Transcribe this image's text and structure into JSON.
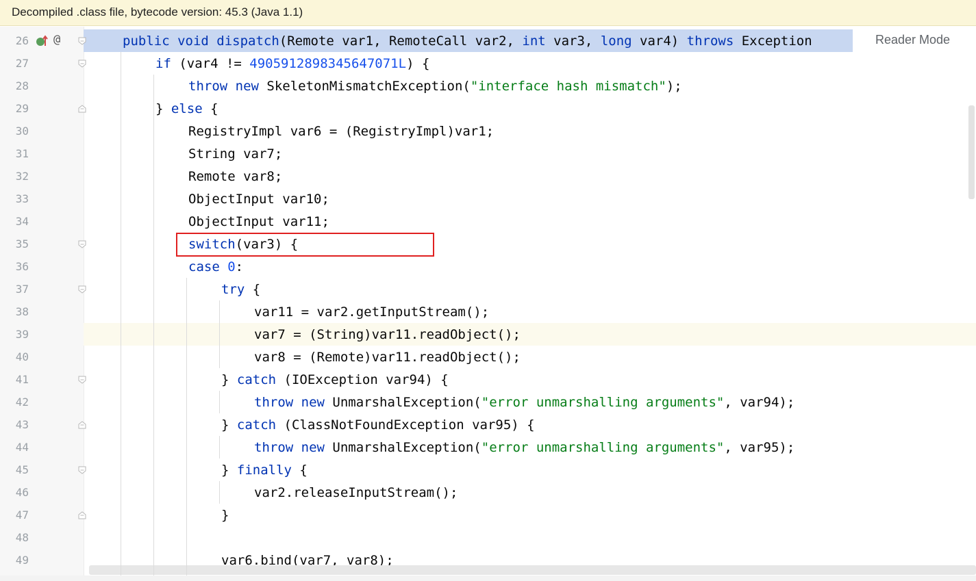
{
  "banner": {
    "text": "Decompiled .class file, bytecode version: 45.3 (Java 1.1)"
  },
  "reader_mode": {
    "label": "Reader Mode"
  },
  "gutter_icons": {
    "implements": "implements-up-icon",
    "annotation": "@"
  },
  "lines": [
    {
      "num": "26",
      "indent": 0,
      "tokens": [
        [
          "kw",
          "public "
        ],
        [
          "kw",
          "void "
        ],
        [
          "kw",
          "dispatch"
        ],
        [
          "",
          "(Remote var1, RemoteCall var2, "
        ],
        [
          "kw",
          "int "
        ],
        [
          "",
          "var3, "
        ],
        [
          "kw",
          "long "
        ],
        [
          "",
          "var4) "
        ],
        [
          "kw",
          "throws "
        ],
        [
          "",
          "Exception"
        ]
      ]
    },
    {
      "num": "27",
      "indent": 1,
      "tokens": [
        [
          "kw",
          "if "
        ],
        [
          "",
          "(var4 != "
        ],
        [
          "num",
          "4905912898345647071L"
        ],
        [
          "",
          ") {"
        ]
      ]
    },
    {
      "num": "28",
      "indent": 2,
      "tokens": [
        [
          "kw",
          "throw "
        ],
        [
          "kw",
          "new "
        ],
        [
          "",
          "SkeletonMismatchException("
        ],
        [
          "str",
          "\"interface hash mismatch\""
        ],
        [
          "",
          ");"
        ]
      ]
    },
    {
      "num": "29",
      "indent": 1,
      "tokens": [
        [
          "",
          "} "
        ],
        [
          "kw",
          "else "
        ],
        [
          "",
          "{"
        ]
      ]
    },
    {
      "num": "30",
      "indent": 2,
      "tokens": [
        [
          "",
          "RegistryImpl var6 = (RegistryImpl)var1;"
        ]
      ]
    },
    {
      "num": "31",
      "indent": 2,
      "tokens": [
        [
          "",
          "String var7;"
        ]
      ]
    },
    {
      "num": "32",
      "indent": 2,
      "tokens": [
        [
          "",
          "Remote var8;"
        ]
      ]
    },
    {
      "num": "33",
      "indent": 2,
      "tokens": [
        [
          "",
          "ObjectInput var10;"
        ]
      ]
    },
    {
      "num": "34",
      "indent": 2,
      "tokens": [
        [
          "",
          "ObjectInput var11;"
        ]
      ]
    },
    {
      "num": "35",
      "indent": 2,
      "tokens": [
        [
          "kw",
          "switch"
        ],
        [
          "",
          "(var3) {"
        ]
      ]
    },
    {
      "num": "36",
      "indent": 2,
      "tokens": [
        [
          "kw",
          "case "
        ],
        [
          "num",
          "0"
        ],
        [
          "",
          ":"
        ]
      ]
    },
    {
      "num": "37",
      "indent": 3,
      "tokens": [
        [
          "kw",
          "try "
        ],
        [
          "",
          "{"
        ]
      ]
    },
    {
      "num": "38",
      "indent": 4,
      "tokens": [
        [
          "",
          "var11 = var2.getInputStream();"
        ]
      ]
    },
    {
      "num": "39",
      "indent": 4,
      "tokens": [
        [
          "",
          "var7 = (String)var11.readObject();"
        ]
      ]
    },
    {
      "num": "40",
      "indent": 4,
      "tokens": [
        [
          "",
          "var8 = (Remote)var11.readObject();"
        ]
      ]
    },
    {
      "num": "41",
      "indent": 3,
      "tokens": [
        [
          "",
          "} "
        ],
        [
          "kw",
          "catch "
        ],
        [
          "",
          "(IOException var94) {"
        ]
      ]
    },
    {
      "num": "42",
      "indent": 4,
      "tokens": [
        [
          "kw",
          "throw "
        ],
        [
          "kw",
          "new "
        ],
        [
          "",
          "UnmarshalException("
        ],
        [
          "str",
          "\"error unmarshalling arguments\""
        ],
        [
          "",
          ", var94);"
        ]
      ]
    },
    {
      "num": "43",
      "indent": 3,
      "tokens": [
        [
          "",
          "} "
        ],
        [
          "kw",
          "catch "
        ],
        [
          "",
          "(ClassNotFoundException var95) {"
        ]
      ]
    },
    {
      "num": "44",
      "indent": 4,
      "tokens": [
        [
          "kw",
          "throw "
        ],
        [
          "kw",
          "new "
        ],
        [
          "",
          "UnmarshalException("
        ],
        [
          "str",
          "\"error unmarshalling arguments\""
        ],
        [
          "",
          ", var95);"
        ]
      ]
    },
    {
      "num": "45",
      "indent": 3,
      "tokens": [
        [
          "",
          "} "
        ],
        [
          "kw",
          "finally "
        ],
        [
          "",
          "{"
        ]
      ]
    },
    {
      "num": "46",
      "indent": 4,
      "tokens": [
        [
          "",
          "var2.releaseInputStream();"
        ]
      ]
    },
    {
      "num": "47",
      "indent": 3,
      "tokens": [
        [
          "",
          "}"
        ]
      ]
    },
    {
      "num": "48",
      "indent": 3,
      "tokens": []
    },
    {
      "num": "49",
      "indent": 3,
      "tokens": [
        [
          "",
          "var6.bind(var7, var8);"
        ]
      ]
    }
  ],
  "colors": {
    "keyword": "#0033b3",
    "number": "#1750eb",
    "string": "#067d17",
    "box": "#e02020"
  }
}
